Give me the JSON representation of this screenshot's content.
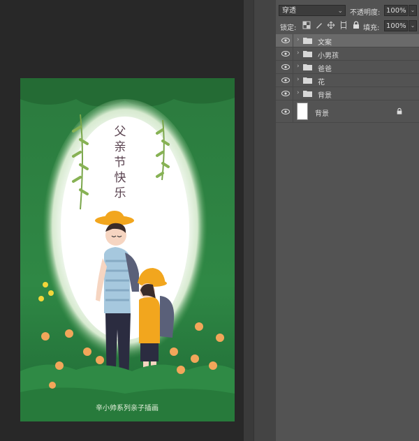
{
  "artwork": {
    "title_chars": [
      "父",
      "亲",
      "节",
      "快",
      "乐"
    ],
    "credit": "辛小帅系列亲子插画",
    "colors": {
      "green_dark": "#1f6b3c",
      "green_mid": "#3f9a53",
      "light": "#ffffff",
      "hat": "#f2a61e",
      "shirt": "#a6c8de"
    }
  },
  "panel": {
    "blend_mode": "穿透",
    "opacity_label": "不透明度:",
    "opacity_value": "100%",
    "lock_label": "锁定:",
    "fill_label": "填充:",
    "fill_value": "100%",
    "layers": [
      {
        "name": "文案",
        "type": "group",
        "selected": true
      },
      {
        "name": "小男孩",
        "type": "group",
        "selected": false
      },
      {
        "name": "爸爸",
        "type": "group",
        "selected": false
      },
      {
        "name": "花",
        "type": "group",
        "selected": false
      },
      {
        "name": "背景",
        "type": "group",
        "selected": false
      }
    ],
    "background_layer": {
      "name": "背景",
      "locked": true
    }
  },
  "icons": [
    "eye-icon",
    "folder-icon",
    "chevron-right-icon",
    "chevron-down-icon",
    "lock-icon",
    "lock-transparent-icon",
    "brush-icon",
    "move-icon",
    "artboard-icon"
  ]
}
